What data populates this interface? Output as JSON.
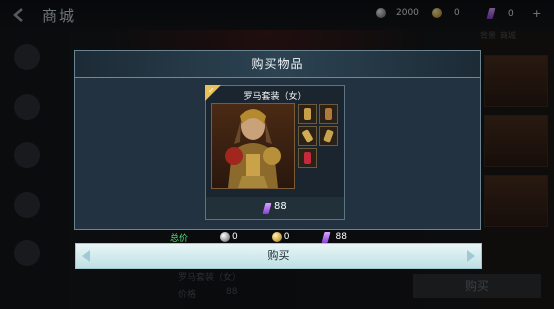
{
  "topbar": {
    "title": "商城",
    "currencies": [
      {
        "icon": "silver-coin-icon",
        "amount": "2000"
      },
      {
        "icon": "gold-coin-icon",
        "amount": "0"
      },
      {
        "icon": "purple-gem-icon",
        "amount": "0"
      }
    ]
  },
  "background": {
    "tabs": [
      "背景",
      "商城"
    ],
    "item_name": "罗马套装（女）",
    "price_label": "价格",
    "price": "88",
    "buy_label": "购买"
  },
  "modal": {
    "title": "购买物品",
    "item": {
      "name": "罗马套装（女）",
      "price": "88",
      "parts": [
        "头饰",
        "护肩",
        "手套",
        "护腕",
        "饰品"
      ]
    },
    "total": {
      "label": "总价",
      "silver": "0",
      "gold": "0",
      "gem": "88"
    },
    "buy_button": "购买"
  },
  "colors": {
    "accent_green": "#5fe07c",
    "gem_purple": "#a45ce6",
    "card_border": "#5c7484"
  }
}
